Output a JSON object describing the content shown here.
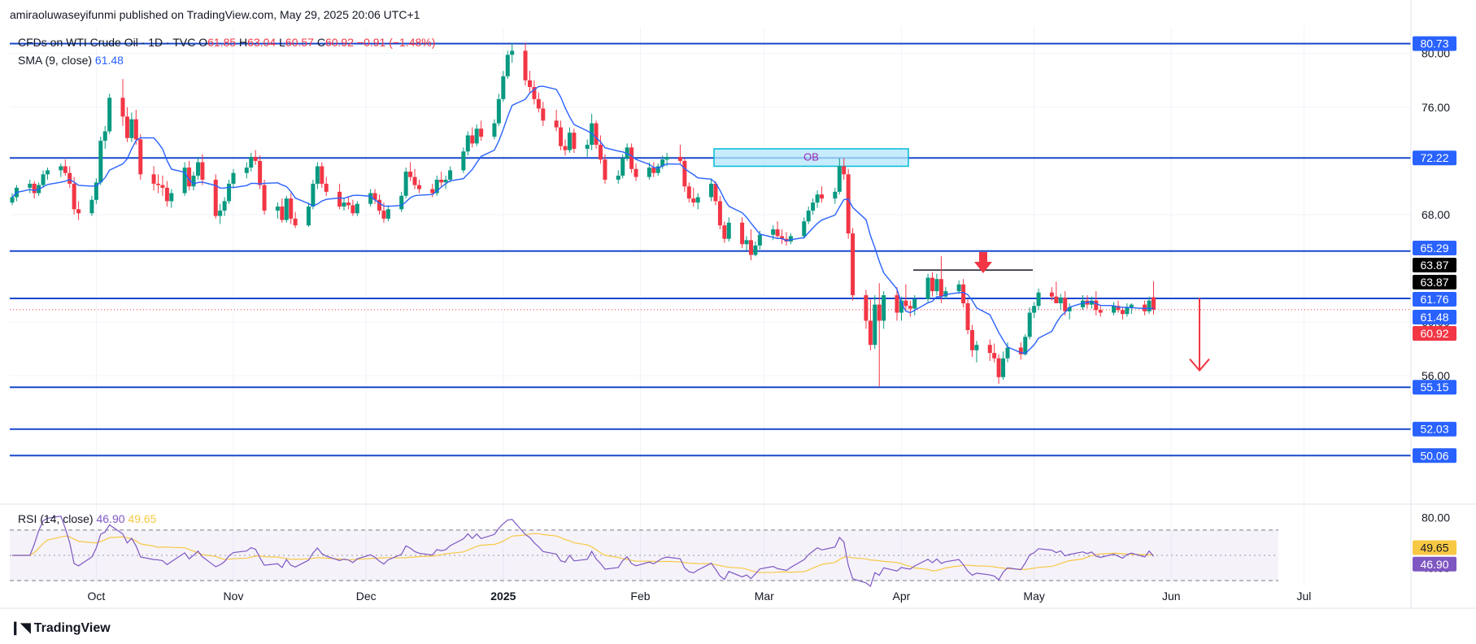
{
  "header": {
    "publisher_line": "amiraoluwaseyifunmi published on TradingView.com, May 29, 2025 20:06 UTC+1"
  },
  "legend": {
    "symbol": "CFDs on WTI Crude Oil · 1D · TVC",
    "o_label": "O",
    "o": "61.85",
    "h_label": "H",
    "h": "63.04",
    "l_label": "L",
    "l": "60.57",
    "c_label": "C",
    "c": "60.92",
    "change": "−0.91 (−1.48%)",
    "sma_label": "SMA (9, close)",
    "sma_value": "61.48",
    "rsi_label": "RSI (14, close)",
    "rsi_value": "46.90",
    "rsi_ma_value": "49.65"
  },
  "footer": {
    "brand": "TradingView"
  },
  "colors": {
    "up": "#089981",
    "down": "#f23645",
    "sma": "#2962ff",
    "level": "#1848cc",
    "rsi": "#7e57c2",
    "rsi_ma": "#f7c843",
    "ob_fill": "#b3e5fc",
    "ob_border": "#00bcd4",
    "label_blue": "#2962ff",
    "label_black": "#000000"
  },
  "chart_data": [
    {
      "type": "candlestick",
      "title": "CFDs on WTI Crude Oil · 1D · TVC",
      "x_ticks": [
        "Oct",
        "Nov",
        "Dec",
        "2025",
        "Feb",
        "Mar",
        "Apr",
        "May",
        "Jun",
        "Jul"
      ],
      "y_ticks": [
        "76.00",
        "68.00",
        "60.00",
        "56.00"
      ],
      "y_tick_80": "80.00",
      "ylim": [
        49.2,
        81.8
      ],
      "start_date": "2024-09-12",
      "ohlc": [
        [
          68.9,
          69.6,
          68.7,
          69.3
        ],
        [
          69.3,
          70.2,
          69.0,
          70.0
        ],
        [
          70.0,
          70.6,
          69.6,
          70.3
        ],
        [
          70.3,
          70.5,
          69.2,
          69.6
        ],
        [
          69.6,
          70.4,
          69.4,
          70.2
        ],
        [
          70.2,
          71.3,
          70.0,
          71.0
        ],
        [
          71.0,
          71.5,
          70.6,
          71.3
        ],
        [
          71.3,
          71.8,
          70.8,
          71.6
        ],
        [
          71.6,
          72.1,
          70.9,
          71.1
        ],
        [
          71.1,
          71.6,
          70.0,
          70.3
        ],
        [
          70.3,
          70.8,
          68.0,
          68.4
        ],
        [
          68.4,
          69.0,
          67.6,
          68.1
        ],
        [
          68.1,
          69.4,
          67.9,
          69.1
        ],
        [
          69.1,
          70.7,
          68.8,
          70.4
        ],
        [
          70.4,
          73.8,
          70.2,
          73.5
        ],
        [
          73.5,
          74.6,
          72.9,
          74.2
        ],
        [
          74.2,
          77.0,
          74.0,
          76.7
        ],
        [
          76.7,
          78.1,
          74.6,
          75.3
        ],
        [
          75.3,
          76.0,
          73.4,
          73.7
        ],
        [
          73.7,
          75.6,
          73.4,
          75.1
        ],
        [
          75.1,
          75.8,
          73.2,
          73.6
        ],
        [
          73.6,
          74.0,
          70.6,
          71.0
        ],
        [
          71.0,
          71.6,
          69.8,
          70.3
        ],
        [
          70.3,
          71.0,
          69.6,
          70.2
        ],
        [
          70.2,
          70.9,
          69.4,
          70.0
        ],
        [
          70.0,
          70.5,
          68.6,
          69.0
        ],
        [
          69.0,
          69.9,
          68.5,
          69.6
        ],
        [
          69.6,
          71.9,
          69.4,
          71.5
        ],
        [
          71.5,
          72.0,
          69.8,
          70.1
        ],
        [
          70.1,
          71.2,
          69.8,
          70.9
        ],
        [
          70.9,
          72.3,
          70.6,
          71.9
        ],
        [
          71.9,
          72.5,
          70.2,
          70.6
        ],
        [
          70.6,
          71.0,
          67.7,
          67.9
        ],
        [
          67.9,
          68.8,
          67.3,
          68.3
        ],
        [
          68.3,
          69.3,
          67.9,
          69.0
        ],
        [
          69.0,
          70.6,
          68.8,
          70.3
        ],
        [
          70.3,
          71.4,
          70.0,
          71.1
        ],
        [
          71.1,
          71.9,
          70.7,
          71.5
        ],
        [
          71.5,
          72.6,
          71.2,
          72.3
        ],
        [
          72.3,
          72.8,
          71.7,
          72.0
        ],
        [
          72.0,
          72.4,
          69.9,
          70.2
        ],
        [
          70.2,
          70.6,
          68.0,
          68.3
        ],
        [
          68.3,
          68.9,
          67.7,
          68.6
        ],
        [
          68.6,
          69.2,
          67.4,
          67.6
        ],
        [
          67.6,
          69.4,
          67.4,
          69.2
        ],
        [
          69.2,
          69.6,
          67.3,
          67.7
        ],
        [
          67.7,
          68.2,
          67.0,
          67.2
        ],
        [
          67.2,
          68.9,
          67.1,
          68.6
        ],
        [
          68.6,
          70.6,
          68.4,
          70.3
        ],
        [
          70.3,
          71.9,
          69.9,
          71.6
        ],
        [
          71.6,
          71.9,
          70.0,
          70.3
        ],
        [
          70.3,
          70.8,
          69.4,
          69.7
        ],
        [
          69.7,
          70.3,
          68.4,
          68.6
        ],
        [
          68.6,
          69.2,
          68.3,
          68.9
        ],
        [
          68.9,
          69.3,
          68.4,
          68.7
        ],
        [
          68.7,
          69.1,
          67.9,
          68.1
        ],
        [
          68.1,
          69.0,
          67.9,
          68.8
        ],
        [
          68.8,
          69.9,
          68.6,
          69.6
        ],
        [
          69.6,
          69.9,
          68.8,
          69.1
        ],
        [
          69.1,
          69.5,
          68.0,
          68.3
        ],
        [
          68.3,
          68.9,
          67.4,
          67.7
        ],
        [
          67.7,
          68.7,
          67.5,
          68.4
        ],
        [
          68.4,
          69.7,
          68.2,
          69.4
        ],
        [
          69.4,
          71.5,
          69.2,
          71.2
        ],
        [
          71.2,
          71.9,
          70.5,
          70.8
        ],
        [
          70.8,
          71.4,
          69.9,
          70.2
        ],
        [
          70.2,
          70.6,
          69.6,
          69.9
        ],
        [
          69.9,
          70.3,
          69.3,
          69.6
        ],
        [
          69.6,
          70.9,
          69.4,
          70.6
        ],
        [
          70.6,
          71.2,
          70.0,
          70.4
        ],
        [
          70.4,
          70.9,
          69.9,
          70.6
        ],
        [
          70.6,
          71.6,
          70.4,
          71.3
        ],
        [
          71.3,
          73.0,
          71.1,
          72.7
        ],
        [
          72.7,
          74.2,
          72.4,
          73.9
        ],
        [
          73.9,
          74.5,
          73.0,
          73.3
        ],
        [
          73.3,
          74.7,
          73.1,
          74.4
        ],
        [
          74.4,
          75.0,
          73.5,
          73.8
        ],
        [
          73.8,
          75.1,
          73.6,
          74.8
        ],
        [
          74.8,
          77.0,
          74.6,
          76.6
        ],
        [
          76.6,
          78.7,
          76.4,
          78.3
        ],
        [
          78.3,
          80.2,
          78.1,
          79.9
        ],
        [
          79.9,
          80.8,
          79.3,
          80.2
        ],
        [
          80.2,
          80.8,
          77.6,
          78.0
        ],
        [
          78.0,
          78.7,
          77.0,
          77.5
        ],
        [
          77.5,
          78.0,
          76.2,
          76.6
        ],
        [
          76.6,
          77.1,
          75.6,
          75.9
        ],
        [
          75.9,
          76.4,
          74.6,
          75.0
        ],
        [
          75.0,
          75.8,
          74.2,
          74.5
        ],
        [
          74.5,
          75.0,
          72.8,
          73.1
        ],
        [
          73.1,
          73.6,
          72.4,
          72.8
        ],
        [
          72.8,
          74.5,
          72.6,
          74.1
        ],
        [
          74.1,
          74.4,
          72.6,
          72.9
        ],
        [
          72.9,
          73.6,
          72.3,
          73.2
        ],
        [
          73.2,
          75.5,
          72.8,
          74.8
        ],
        [
          74.8,
          75.0,
          72.9,
          73.2
        ],
        [
          73.2,
          73.9,
          71.8,
          72.1
        ],
        [
          72.1,
          72.5,
          70.3,
          70.6
        ],
        [
          70.6,
          71.3,
          70.3,
          70.9
        ],
        [
          70.9,
          72.5,
          70.7,
          72.2
        ],
        [
          72.2,
          73.3,
          72.0,
          73.0
        ],
        [
          73.0,
          73.3,
          71.1,
          71.4
        ],
        [
          71.4,
          71.8,
          70.5,
          70.8
        ],
        [
          70.8,
          71.9,
          70.6,
          71.5
        ],
        [
          71.5,
          71.9,
          70.8,
          71.1
        ],
        [
          71.1,
          71.8,
          70.9,
          71.6
        ],
        [
          71.6,
          72.4,
          71.4,
          72.1
        ],
        [
          72.1,
          72.6,
          71.6,
          72.3
        ],
        [
          72.3,
          73.2,
          71.8,
          72.0
        ],
        [
          72.0,
          72.2,
          69.7,
          70.1
        ],
        [
          70.1,
          70.4,
          68.9,
          69.2
        ],
        [
          69.2,
          70.0,
          68.6,
          68.9
        ],
        [
          68.9,
          69.6,
          68.4,
          69.3
        ],
        [
          69.3,
          70.6,
          69.0,
          70.3
        ],
        [
          70.3,
          70.5,
          68.7,
          69.0
        ],
        [
          69.0,
          69.4,
          66.9,
          67.2
        ],
        [
          67.2,
          67.5,
          65.9,
          66.2
        ],
        [
          66.2,
          67.8,
          66.0,
          67.4
        ],
        [
          67.4,
          67.8,
          65.5,
          65.8
        ],
        [
          65.8,
          66.4,
          65.3,
          66.1
        ],
        [
          66.1,
          66.9,
          64.6,
          65.0
        ],
        [
          65.0,
          66.0,
          64.9,
          65.7
        ],
        [
          65.7,
          66.8,
          65.4,
          66.5
        ],
        [
          66.5,
          67.2,
          66.1,
          66.9
        ],
        [
          66.9,
          67.5,
          66.2,
          66.4
        ],
        [
          66.4,
          66.9,
          65.8,
          66.2
        ],
        [
          66.2,
          66.7,
          65.7,
          66.0
        ],
        [
          66.0,
          66.6,
          65.8,
          66.4
        ],
        [
          66.4,
          67.8,
          66.2,
          67.5
        ],
        [
          67.5,
          68.6,
          67.3,
          68.3
        ],
        [
          68.3,
          69.2,
          68.0,
          68.9
        ],
        [
          68.9,
          69.8,
          68.5,
          69.5
        ],
        [
          69.5,
          70.1,
          68.9,
          69.2
        ],
        [
          69.2,
          70.0,
          68.8,
          69.7
        ],
        [
          69.7,
          72.2,
          69.5,
          71.6
        ],
        [
          71.6,
          72.2,
          70.6,
          71.0
        ],
        [
          71.0,
          71.4,
          66.2,
          66.6
        ],
        [
          66.6,
          67.0,
          61.6,
          62.0
        ],
        [
          62.0,
          62.4,
          59.5,
          60.1
        ],
        [
          60.1,
          61.7,
          57.9,
          58.3
        ],
        [
          58.3,
          62.0,
          58.0,
          61.3
        ],
        [
          61.3,
          62.9,
          55.2,
          60.1
        ],
        [
          60.1,
          62.3,
          59.5,
          62.0
        ],
        [
          62.0,
          62.6,
          60.1,
          60.7
        ],
        [
          60.7,
          61.9,
          60.1,
          61.6
        ],
        [
          61.6,
          62.8,
          60.8,
          61.2
        ],
        [
          61.2,
          61.6,
          60.4,
          61.0
        ],
        [
          61.0,
          62.0,
          60.5,
          61.7
        ],
        [
          61.7,
          63.6,
          61.4,
          63.3
        ],
        [
          63.3,
          63.7,
          61.9,
          62.3
        ],
        [
          62.3,
          63.6,
          62.0,
          63.2
        ],
        [
          63.2,
          64.9,
          61.4,
          61.9
        ],
        [
          61.9,
          62.6,
          61.7,
          62.3
        ],
        [
          62.3,
          63.1,
          62.1,
          62.8
        ],
        [
          62.8,
          63.2,
          61.1,
          61.4
        ],
        [
          61.4,
          61.7,
          59.1,
          59.4
        ],
        [
          59.4,
          59.8,
          57.4,
          57.9
        ],
        [
          57.9,
          58.6,
          57.0,
          58.3
        ],
        [
          58.3,
          58.7,
          57.1,
          57.7
        ],
        [
          57.7,
          58.4,
          57.0,
          57.3
        ],
        [
          57.3,
          57.6,
          55.4,
          55.9
        ],
        [
          55.9,
          57.8,
          55.7,
          57.3
        ],
        [
          57.3,
          58.5,
          57.0,
          58.1
        ],
        [
          58.1,
          58.5,
          57.2,
          57.6
        ],
        [
          57.6,
          59.1,
          57.5,
          58.9
        ],
        [
          58.9,
          61.1,
          58.7,
          60.7
        ],
        [
          60.7,
          61.5,
          60.3,
          61.2
        ],
        [
          61.2,
          62.5,
          60.9,
          62.2
        ],
        [
          62.2,
          62.6,
          61.6,
          61.9
        ],
        [
          61.9,
          63.0,
          61.7,
          61.4
        ],
        [
          61.4,
          62.1,
          60.9,
          61.8
        ],
        [
          61.8,
          62.3,
          60.5,
          60.8
        ],
        [
          60.8,
          61.4,
          60.2,
          61.1
        ],
        [
          61.1,
          62.0,
          60.9,
          61.6
        ],
        [
          61.6,
          62.0,
          61.0,
          61.3
        ],
        [
          61.3,
          61.9,
          61.0,
          61.6
        ],
        [
          61.6,
          62.3,
          60.5,
          60.9
        ],
        [
          60.9,
          61.2,
          60.4,
          60.7
        ],
        [
          60.7,
          61.5,
          60.5,
          61.2
        ],
        [
          61.2,
          61.6,
          60.7,
          60.9
        ],
        [
          60.9,
          61.1,
          60.2,
          60.6
        ],
        [
          60.6,
          61.4,
          60.4,
          61.1
        ],
        [
          61.1,
          61.4,
          60.6,
          61.3
        ],
        [
          61.3,
          61.6,
          60.5,
          60.8
        ],
        [
          60.8,
          61.9,
          60.6,
          61.6
        ],
        [
          61.85,
          63.04,
          60.57,
          60.92
        ]
      ],
      "levels": [
        {
          "price": 80.73,
          "label": "80.73"
        },
        {
          "price": 72.22,
          "label": "72.22"
        },
        {
          "price": 65.29,
          "label": "65.29"
        },
        {
          "price": 61.76,
          "label": "61.76"
        },
        {
          "price": 55.15,
          "label": "55.15"
        },
        {
          "price": 52.03,
          "label": "52.03"
        },
        {
          "price": 50.06,
          "label": "50.06"
        }
      ],
      "price_labels": [
        {
          "price": 65.29,
          "text": "65.29",
          "style": "blue"
        },
        {
          "price": 63.87,
          "text": "63.87",
          "style": "black"
        },
        {
          "price": 63.87,
          "text": "63.87",
          "style": "black"
        },
        {
          "price": 61.76,
          "text": "61.76",
          "style": "blue"
        },
        {
          "price": 61.48,
          "text": "61.48",
          "style": "blue"
        },
        {
          "price": 60.92,
          "text": "60.92",
          "style": "red"
        }
      ],
      "last_close": 60.92,
      "order_block": {
        "label": "OB",
        "top": 72.9,
        "bottom": 71.6
      },
      "resistance_line": 63.87,
      "arrow_down": {
        "from": 61.8,
        "to": 56.4
      },
      "sma_period": 9
    },
    {
      "type": "line",
      "title": "RSI (14, close)",
      "y_ticks": [
        "80.00",
        "40.00"
      ],
      "ylim": [
        30,
        88
      ],
      "bands": [
        70,
        30
      ],
      "series": [
        {
          "name": "RSI (14, close)",
          "last": 46.9
        },
        {
          "name": "",
          "last": 49.65
        }
      ]
    }
  ]
}
